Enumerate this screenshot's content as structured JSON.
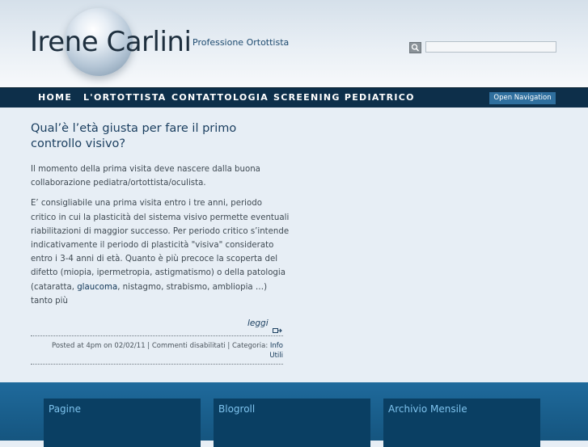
{
  "header": {
    "title": "Irene Carlini",
    "tagline": "Professione Ortottista",
    "search": {
      "value": ""
    }
  },
  "nav": {
    "items": [
      "HOME",
      "L'ORTOTTISTA",
      "CONTATTOLOGIA",
      "SCREENING PEDIATRICO"
    ],
    "open_navigation": "Open Navigation"
  },
  "post": {
    "title": "Qual’è l’età giusta per fare il primo controllo visivo?",
    "p1": "Il momento della prima visita deve nascere dalla buona collaborazione pediatra/ortottista/oculista.",
    "p2_before": "E’ consigliabile una prima visita entro i tre anni, periodo critico in cui la plasticità del sistema visivo permette eventuali riabilitazioni di maggior successo. Per periodo critico s’intende indicativamente il periodo di plasticità \"visiva\" considerato entro i 3-4 anni di età. Quanto è più precoce la scoperta del difetto (miopia, ipermetropia, astigmatismo) o della patologia (cataratta, ",
    "p2_link": "glaucoma",
    "p2_after": ", nistagmo, strabismo, ambliopia …) tanto più",
    "read_more": "leggi",
    "meta_line1": "Posted at 4pm on 02/02/11 | Commenti disabilitati | Categoria: ",
    "meta_cat1": "Info",
    "meta_cat2": "Utili"
  },
  "footer": {
    "widgets": [
      "Pagine",
      "Blogroll",
      "Archivio Mensile"
    ]
  }
}
